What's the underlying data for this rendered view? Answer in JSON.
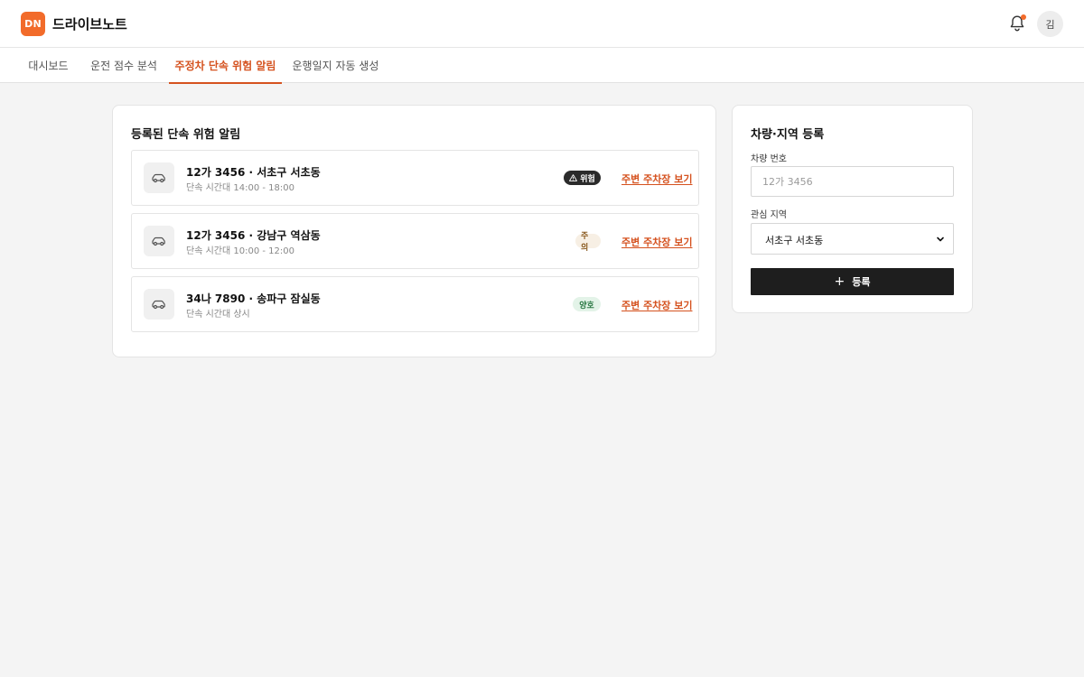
{
  "header": {
    "logo_text": "DN",
    "app_name": "드라이브노트",
    "avatar_initial": "김",
    "notification_icon": "bell-icon",
    "accent_color": "#f26b2a"
  },
  "tabs": [
    {
      "label": "대시보드",
      "active": false
    },
    {
      "label": "운전 점수 분석",
      "active": false
    },
    {
      "label": "주정차 단속 위험 알림",
      "active": true
    },
    {
      "label": "운행일지 자동 생성",
      "active": false
    }
  ],
  "alerts": {
    "title": "등록된 단속 위험 알림",
    "items": [
      {
        "title": "12가 3456 · 서초구 서초동",
        "schedule": "단속 시간대 14:00 - 18:00",
        "badge": "위험",
        "badge_icon": "warning-icon",
        "level": "danger",
        "link": "주변 주차장 보기"
      },
      {
        "title": "12가 3456 · 강남구 역삼동",
        "schedule": "단속 시간대 10:00 - 12:00",
        "badge": "주의",
        "level": "caution",
        "link": "주변 주차장 보기"
      },
      {
        "title": "34나 7890 · 송파구 잠실동",
        "schedule": "단속 시간대 상시",
        "badge": "양호",
        "level": "good",
        "link": "주변 주차장 보기"
      }
    ]
  },
  "register": {
    "title": "차량·지역 등록",
    "vehicle_label": "차량 번호",
    "vehicle_placeholder": "12가 3456",
    "vehicle_value": "",
    "region_label": "관심 지역",
    "region_value": "서초구 서초동",
    "submit_label": "등록",
    "submit_icon": "plus-icon"
  }
}
